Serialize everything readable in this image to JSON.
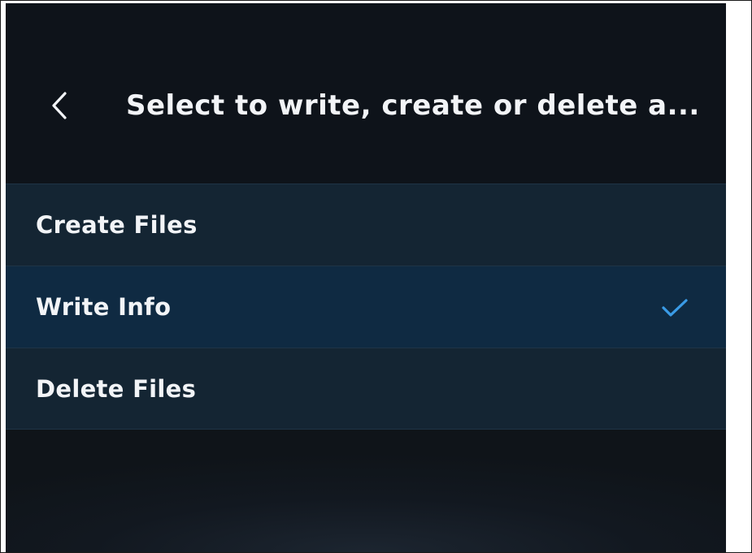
{
  "header": {
    "back_icon": "chevron-left-icon",
    "title": "Select to write, create or delete a..."
  },
  "options": [
    {
      "label": "Create Files",
      "selected": false
    },
    {
      "label": "Write Info",
      "selected": true,
      "indicator_icon": "checkmark-icon"
    },
    {
      "label": "Delete Files",
      "selected": false
    }
  ],
  "colors": {
    "background": "#0f1419",
    "item_background": "#142533",
    "selected_background": "#0f2a42",
    "text": "#f2f4f7",
    "accent": "#3a9be6"
  }
}
